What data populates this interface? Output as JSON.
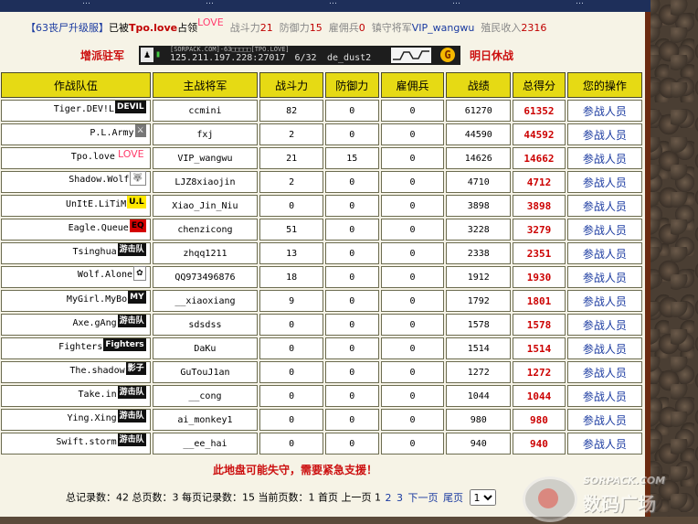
{
  "topnav": [
    "…",
    "…",
    "…",
    "…",
    "…"
  ],
  "info": {
    "server": "【63丧尸升级服】",
    "occupied_prefix": "已被",
    "occupier": "Tpo.love",
    "occupier_logo": "LOVE",
    "occupied_suffix": "占领",
    "attack_label": "战斗力",
    "attack_value": "21",
    "defense_label": "防御力",
    "defense_value": "15",
    "merc_label": "雇佣兵",
    "merc_value": "0",
    "general_label": "镇守将军",
    "general_value": "VIP_wangwu",
    "income_label": "殖民收入",
    "income_value": "2316"
  },
  "actions": {
    "deploy": "增派驻军",
    "tomorrow": "明日休战"
  },
  "server_banner": {
    "header": "[SORPACK.COM]-63□□□□□[TPO.LOVE]",
    "ip": "125.211.197.228:27017",
    "players": "6/32",
    "map": "de_dust2"
  },
  "table": {
    "headers": [
      "作战队伍",
      "主战将军",
      "战斗力",
      "防御力",
      "雇佣兵",
      "战绩",
      "总得分",
      "您的操作"
    ],
    "rows": [
      {
        "team": "Tiger.DEV!L",
        "logo": "DEVIL",
        "logo_style": "lg-black",
        "general": "ccmini",
        "attack": "82",
        "defense": "0",
        "merc": "0",
        "record": "61270",
        "score": "61352",
        "op": "参战人员"
      },
      {
        "team": "P.L.Army",
        "logo": "⚔",
        "logo_style": "lg-grey",
        "general": "fxj",
        "attack": "2",
        "defense": "0",
        "merc": "0",
        "record": "44590",
        "score": "44592",
        "op": "参战人员"
      },
      {
        "team": "Tpo.love",
        "logo": "LOVE",
        "logo_style": "lg-pink",
        "general": "VIP_wangwu",
        "attack": "21",
        "defense": "15",
        "merc": "0",
        "record": "14626",
        "score": "14662",
        "op": "参战人员"
      },
      {
        "team": "Shadow.Wolf",
        "logo": "🐺",
        "logo_style": "lg-white",
        "general": "LJZ8xiaojin",
        "attack": "2",
        "defense": "0",
        "merc": "0",
        "record": "4710",
        "score": "4712",
        "op": "参战人员"
      },
      {
        "team": "UnItE.LiTiM",
        "logo": "U.L",
        "logo_style": "lg-yellow",
        "general": "Xiao_Jin_Niu",
        "attack": "0",
        "defense": "0",
        "merc": "0",
        "record": "3898",
        "score": "3898",
        "op": "参战人员"
      },
      {
        "team": "Eagle.Queue",
        "logo": "EQ",
        "logo_style": "lg-red",
        "general": "chenzicong",
        "attack": "51",
        "defense": "0",
        "merc": "0",
        "record": "3228",
        "score": "3279",
        "op": "参战人员"
      },
      {
        "team": "Tsinghua",
        "logo": "游击队",
        "logo_style": "lg-black",
        "general": "zhqq1211",
        "attack": "13",
        "defense": "0",
        "merc": "0",
        "record": "2338",
        "score": "2351",
        "op": "参战人员"
      },
      {
        "team": "Wolf.Alone",
        "logo": "✿",
        "logo_style": "lg-white",
        "general": "QQ973496876",
        "attack": "18",
        "defense": "0",
        "merc": "0",
        "record": "1912",
        "score": "1930",
        "op": "参战人员"
      },
      {
        "team": "MyGirl.MyBo",
        "logo": "MY",
        "logo_style": "lg-black",
        "general": "__xiaoxiang",
        "attack": "9",
        "defense": "0",
        "merc": "0",
        "record": "1792",
        "score": "1801",
        "op": "参战人员"
      },
      {
        "team": "Axe.gAng",
        "logo": "游击队",
        "logo_style": "lg-black",
        "general": "sdsdss",
        "attack": "0",
        "defense": "0",
        "merc": "0",
        "record": "1578",
        "score": "1578",
        "op": "参战人员"
      },
      {
        "team": "Fighters",
        "logo": "Fighters",
        "logo_style": "lg-black",
        "general": "DaKu",
        "attack": "0",
        "defense": "0",
        "merc": "0",
        "record": "1514",
        "score": "1514",
        "op": "参战人员"
      },
      {
        "team": "The.shadow",
        "logo": "影子",
        "logo_style": "lg-black",
        "general": "GuTouJ1an",
        "attack": "0",
        "defense": "0",
        "merc": "0",
        "record": "1272",
        "score": "1272",
        "op": "参战人员"
      },
      {
        "team": "Take.in",
        "logo": "游击队",
        "logo_style": "lg-black",
        "general": "__cong",
        "attack": "0",
        "defense": "0",
        "merc": "0",
        "record": "1044",
        "score": "1044",
        "op": "参战人员"
      },
      {
        "team": "Ying.Xing",
        "logo": "游击队",
        "logo_style": "lg-black",
        "general": "ai_monkey1",
        "attack": "0",
        "defense": "0",
        "merc": "0",
        "record": "980",
        "score": "980",
        "op": "参战人员"
      },
      {
        "team": "Swift.storm",
        "logo": "游击队",
        "logo_style": "lg-black",
        "general": "__ee_hai",
        "attack": "0",
        "defense": "0",
        "merc": "0",
        "record": "940",
        "score": "940",
        "op": "参战人员"
      }
    ]
  },
  "warning": "此地盘可能失守，需要紧急支援！",
  "pager": {
    "total_records_label": "总记录数：",
    "total_records": "42",
    "total_pages_label": "总页数：",
    "total_pages": "3",
    "per_page_label": "每页记录数：",
    "per_page": "15",
    "current_label": "当前页数：",
    "current": "1",
    "first": "首页",
    "prev": "上一页",
    "pages": [
      "1",
      "2",
      "3"
    ],
    "next": "下一页",
    "last": "尾页",
    "select_value": "1"
  },
  "watermark": {
    "line1": "SORPACK.COM",
    "line2": "数码广场"
  }
}
